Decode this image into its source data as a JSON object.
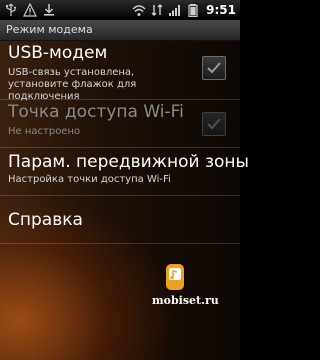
{
  "status_bar": {
    "icons": [
      "usb-icon",
      "warning-icon",
      "download-icon",
      "wifi-icon",
      "network-icon",
      "signal-icon",
      "battery-icon"
    ],
    "time": "9:51"
  },
  "title_bar": {
    "title": "Режим модема"
  },
  "settings": [
    {
      "title": "USB-модем",
      "subtitle": "USB-связь установлена, установите флажок для подключения",
      "checkbox": true,
      "enabled": true
    },
    {
      "title": "Точка доступа Wi-Fi",
      "subtitle": "Не настроено",
      "checkbox": true,
      "enabled": false
    },
    {
      "title": "Парам. передвижной зоны",
      "subtitle": "Настройка точки доступа Wi-Fi",
      "checkbox": false,
      "enabled": true
    },
    {
      "title": "Справка",
      "subtitle": "",
      "checkbox": false,
      "enabled": true
    }
  ],
  "watermark": {
    "text": "mobiset.ru"
  },
  "colors": {
    "accent": "#f0a020",
    "background": "#2a1408"
  }
}
